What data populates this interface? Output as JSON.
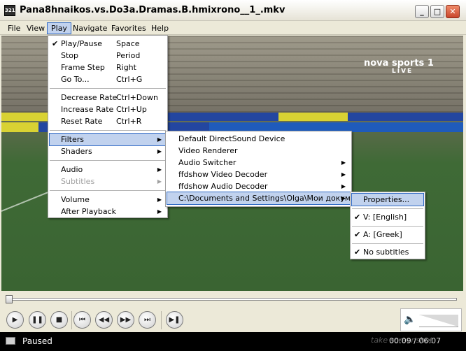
{
  "window": {
    "title": "Pana8hnaikos.vs.Do3a.Dramas.B.hmixrono__1_.mkv",
    "app_icon_text": "321",
    "buttons": {
      "minimize": "_",
      "maximize": "□",
      "close": "✕"
    }
  },
  "menubar": [
    "File",
    "View",
    "Play",
    "Navigate",
    "Favorites",
    "Help"
  ],
  "video_overlay": {
    "channel": "nova sports 1",
    "live": "LIVE"
  },
  "play_menu": {
    "groups": [
      [
        {
          "label": "Play/Pause",
          "key": "Space",
          "checked": true
        },
        {
          "label": "Stop",
          "key": "Period"
        },
        {
          "label": "Frame Step",
          "key": "Right"
        },
        {
          "label": "Go To...",
          "key": "Ctrl+G"
        }
      ],
      [
        {
          "label": "Decrease Rate",
          "key": "Ctrl+Down"
        },
        {
          "label": "Increase Rate",
          "key": "Ctrl+Up"
        },
        {
          "label": "Reset Rate",
          "key": "Ctrl+R"
        }
      ],
      [
        {
          "label": "Filters",
          "submenu": true,
          "highlighted": true
        },
        {
          "label": "Shaders",
          "submenu": true
        }
      ],
      [
        {
          "label": "Audio",
          "submenu": true
        },
        {
          "label": "Subtitles",
          "submenu": true,
          "disabled": true
        }
      ],
      [
        {
          "label": "Volume",
          "submenu": true
        },
        {
          "label": "After Playback",
          "submenu": true
        }
      ]
    ]
  },
  "filters_menu": [
    {
      "label": "Default DirectSound Device"
    },
    {
      "label": "Video Renderer"
    },
    {
      "label": "Audio Switcher",
      "submenu": true
    },
    {
      "label": "ffdshow Video Decoder",
      "submenu": true
    },
    {
      "label": "ffdshow Audio Decoder",
      "submenu": true
    },
    {
      "label": "C:\\Documents and Settings\\Olga\\Мои докум...",
      "submenu": true,
      "highlighted": true
    }
  ],
  "file_menu": {
    "properties": "Properties...",
    "video_track": "V: [English]",
    "audio_track": "A: [Greek]",
    "subtitles": "No subtitles"
  },
  "controls": {
    "play": "play-icon",
    "pause": "pause-icon",
    "stop": "stop-icon",
    "prev": "skip-back-icon",
    "rewind": "rewind-icon",
    "forward": "fast-forward-icon",
    "next": "skip-forward-icon",
    "frame_step": "frame-step-icon"
  },
  "status": {
    "text": "Paused",
    "time": "00:09 / 06:07"
  },
  "watermark": "take screenshot",
  "colors": {
    "menu_highlight": "#c1d2ee",
    "highlight_border": "#316ac5",
    "status_bg": "#000000"
  }
}
